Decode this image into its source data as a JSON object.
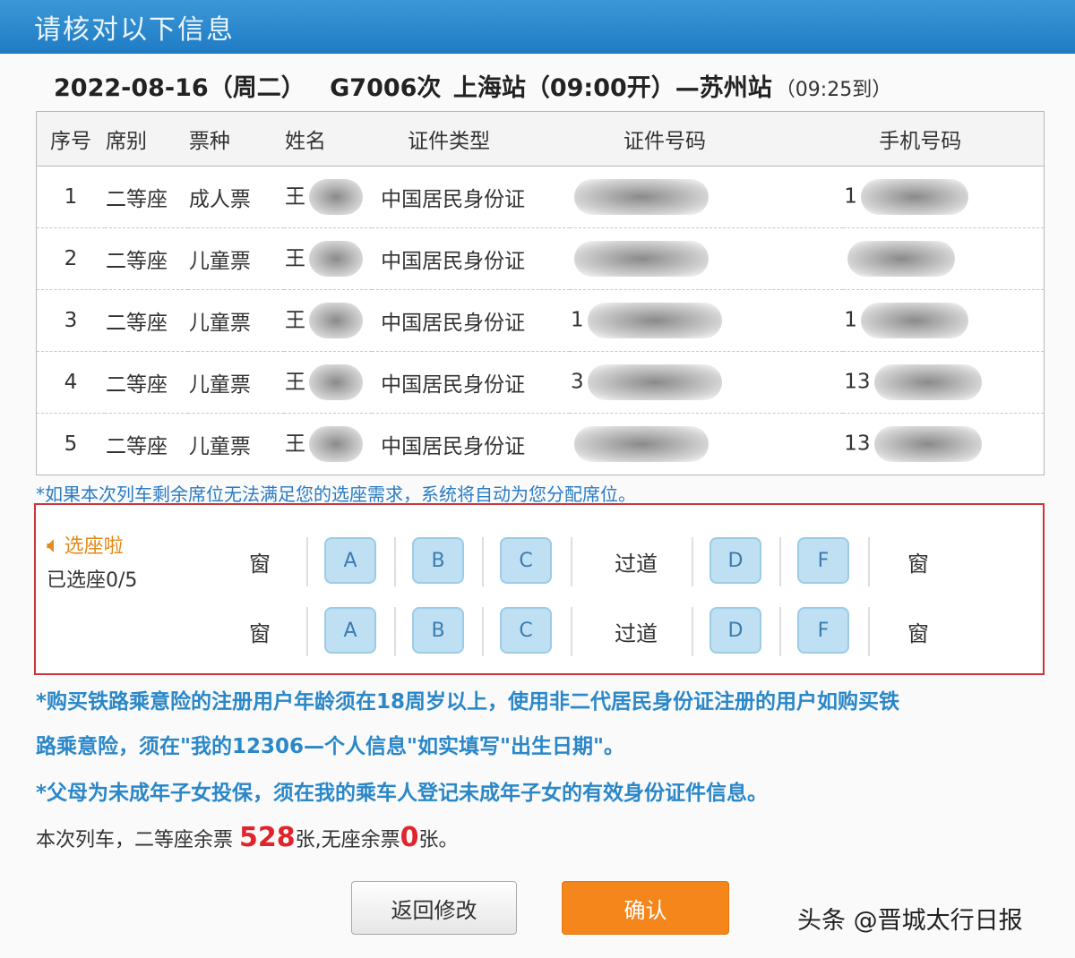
{
  "header": {
    "title": "请核对以下信息"
  },
  "trip": {
    "date": "2022-08-16（周二）",
    "train": "G7006次",
    "route": "上海站（09:00开）—苏州站",
    "arrive": "（09:25到）"
  },
  "table": {
    "headers": [
      "序号",
      "席别",
      "票种",
      "姓名",
      "证件类型",
      "证件号码",
      "手机号码"
    ],
    "rows": [
      {
        "no": "1",
        "seat": "二等座",
        "ticket": "成人票",
        "name": "王",
        "idtype": "中国居民身份证",
        "idno": "",
        "phone": "1"
      },
      {
        "no": "2",
        "seat": "二等座",
        "ticket": "儿童票",
        "name": "王",
        "idtype": "中国居民身份证",
        "idno": "",
        "phone": ""
      },
      {
        "no": "3",
        "seat": "二等座",
        "ticket": "儿童票",
        "name": "王",
        "idtype": "中国居民身份证",
        "idno": "1",
        "phone": "1"
      },
      {
        "no": "4",
        "seat": "二等座",
        "ticket": "儿童票",
        "name": "王",
        "idtype": "中国居民身份证",
        "idno": "3",
        "phone": "13"
      },
      {
        "no": "5",
        "seat": "二等座",
        "ticket": "儿童票",
        "name": "王",
        "idtype": "中国居民身份证",
        "idno": "",
        "phone": "13"
      }
    ]
  },
  "hint": "*如果本次列车剩余席位无法满足您的选座需求，系统将自动为您分配席位。",
  "seat_select": {
    "label": "选座啦",
    "count": "已选座0/5",
    "window_left": "窗",
    "seats": [
      "A",
      "B",
      "C",
      "D",
      "F"
    ],
    "aisle": "过道",
    "window_right": "窗"
  },
  "notices": [
    "*购买铁路乘意险的注册用户年龄须在18周岁以上，使用非二代居民身份证注册的用户如购买铁",
    "路乘意险，须在\"我的12306—个人信息\"如实填写\"出生日期\"。",
    "*父母为未成年子女投保，须在我的乘车人登记未成年子女的有效身份证件信息。"
  ],
  "remain": {
    "prefix": "本次列车，二等座余票",
    "second_count": "528",
    "mid": "张,无座余票",
    "noseat_count": "0",
    "suffix": "张。"
  },
  "buttons": {
    "back": "返回修改",
    "confirm": "确认"
  },
  "watermark": "头条 @晋城太行日报",
  "colors": {
    "header": "#1f7cc4",
    "confirm": "#f4861b",
    "highlight_border": "#c9353a",
    "count_red": "#e0242b"
  }
}
